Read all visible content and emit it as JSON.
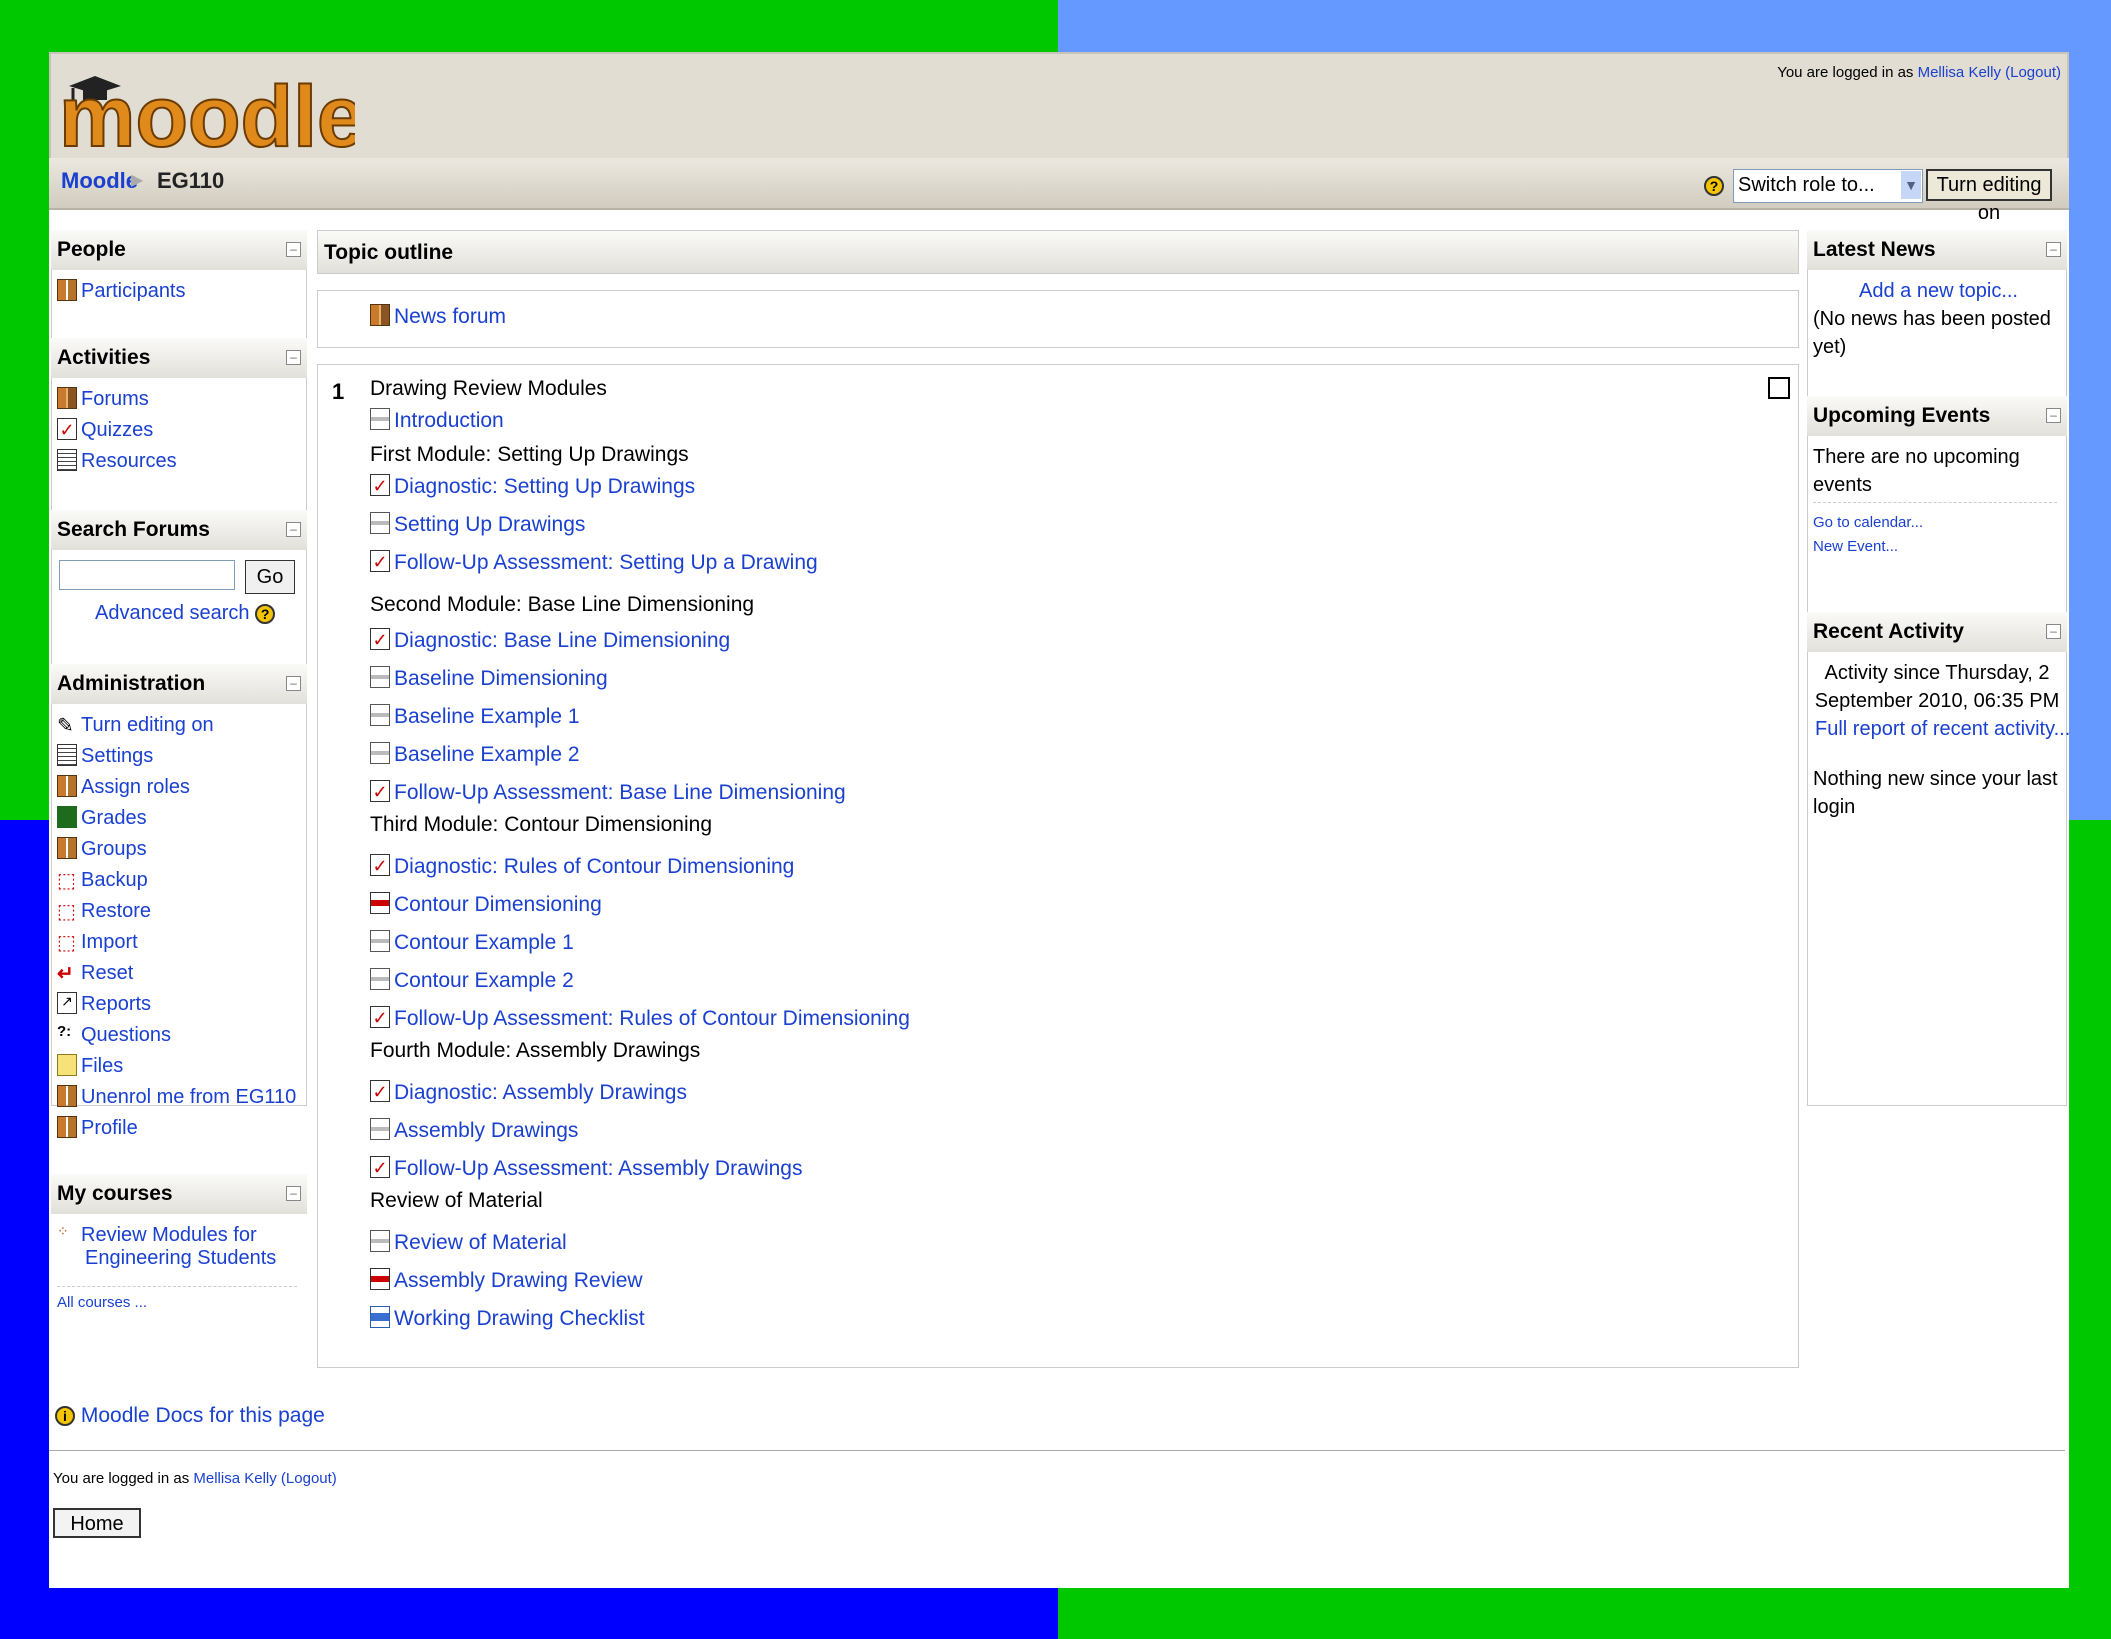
{
  "header": {
    "logo_text": "moodle",
    "login_prefix": "You are logged in as ",
    "user_name": "Mellisa Kelly",
    "logout": "(Logout)"
  },
  "navbar": {
    "home": "Moodle",
    "separator": "▶",
    "current": "EG110",
    "role_select": "Switch role to...",
    "edit_button": "Turn editing on"
  },
  "left": {
    "people": {
      "title": "People",
      "items": [
        "Participants"
      ]
    },
    "activities": {
      "title": "Activities",
      "items": [
        "Forums",
        "Quizzes",
        "Resources"
      ]
    },
    "search": {
      "title": "Search Forums",
      "go": "Go",
      "advanced": "Advanced search"
    },
    "admin": {
      "title": "Administration",
      "items": [
        "Turn editing on",
        "Settings",
        "Assign roles",
        "Grades",
        "Groups",
        "Backup",
        "Restore",
        "Import",
        "Reset",
        "Reports",
        "Questions",
        "Files",
        "Unenrol me from EG110",
        "Profile"
      ]
    },
    "courses": {
      "title": "My courses",
      "course_line1": "Review Modules for",
      "course_line2": "Engineering Students",
      "all": "All courses ..."
    }
  },
  "center": {
    "title": "Topic outline",
    "news_forum": "News forum",
    "section_number": "1",
    "section_title": "Drawing Review Modules",
    "items": [
      {
        "type": "link",
        "icon": "web",
        "text": "Introduction"
      },
      {
        "type": "label",
        "text": "First Module: Setting Up Drawings"
      },
      {
        "type": "link",
        "icon": "quiz",
        "text": "Diagnostic: Setting Up Drawings"
      },
      {
        "type": "link",
        "icon": "web",
        "text": "Setting Up Drawings"
      },
      {
        "type": "link",
        "icon": "quiz",
        "text": "Follow-Up Assessment: Setting Up a Drawing"
      },
      {
        "type": "label",
        "text": "Second Module: Base Line Dimensioning"
      },
      {
        "type": "link",
        "icon": "quiz",
        "text": "Diagnostic: Base Line Dimensioning"
      },
      {
        "type": "link",
        "icon": "web",
        "text": "Baseline Dimensioning"
      },
      {
        "type": "link",
        "icon": "web",
        "text": "Baseline Example 1"
      },
      {
        "type": "link",
        "icon": "web",
        "text": "Baseline Example 2"
      },
      {
        "type": "link",
        "icon": "quiz",
        "text": "Follow-Up Assessment: Base Line Dimensioning"
      },
      {
        "type": "label",
        "text": "Third Module: Contour Dimensioning"
      },
      {
        "type": "link",
        "icon": "quiz",
        "text": "Diagnostic: Rules of Contour Dimensioning"
      },
      {
        "type": "link",
        "icon": "pdf",
        "text": "Contour Dimensioning"
      },
      {
        "type": "link",
        "icon": "web",
        "text": "Contour Example 1"
      },
      {
        "type": "link",
        "icon": "web",
        "text": "Contour Example 2"
      },
      {
        "type": "link",
        "icon": "quiz",
        "text": "Follow-Up Assessment: Rules of Contour Dimensioning"
      },
      {
        "type": "label",
        "text": "Fourth Module: Assembly Drawings"
      },
      {
        "type": "link",
        "icon": "quiz",
        "text": "Diagnostic: Assembly Drawings"
      },
      {
        "type": "link",
        "icon": "web",
        "text": "Assembly Drawings"
      },
      {
        "type": "link",
        "icon": "quiz",
        "text": "Follow-Up Assessment: Assembly Drawings"
      },
      {
        "type": "label",
        "text": "Review of Material"
      },
      {
        "type": "link",
        "icon": "web",
        "text": "Review of Material"
      },
      {
        "type": "link",
        "icon": "pdf",
        "text": "Assembly Drawing Review"
      },
      {
        "type": "link",
        "icon": "doc",
        "text": "Working Drawing Checklist"
      }
    ]
  },
  "right": {
    "news": {
      "title": "Latest News",
      "add": "Add a new topic...",
      "empty1": "(No news has been posted",
      "empty2": "yet)"
    },
    "events": {
      "title": "Upcoming Events",
      "empty1": "There are no upcoming",
      "empty2": "events",
      "calendar": "Go to calendar...",
      "new_event": "New Event..."
    },
    "recent": {
      "title": "Recent Activity",
      "since1": "Activity since Thursday, 2",
      "since2": "September 2010, 06:35 PM",
      "full": "Full report of recent activity...",
      "none1": "Nothing new since your last",
      "none2": "login"
    }
  },
  "footer": {
    "docs": "Moodle Docs for this page",
    "login_prefix": "You are logged in as ",
    "user_name": "Mellisa Kelly",
    "logout": "(Logout)",
    "home": "Home"
  },
  "colors": {
    "link": "#1a40d0",
    "header_bg": "#e1ddd3",
    "bg_green": "#00c800",
    "bg_blue": "#0000ff",
    "bg_lightblue": "#6699ff"
  }
}
